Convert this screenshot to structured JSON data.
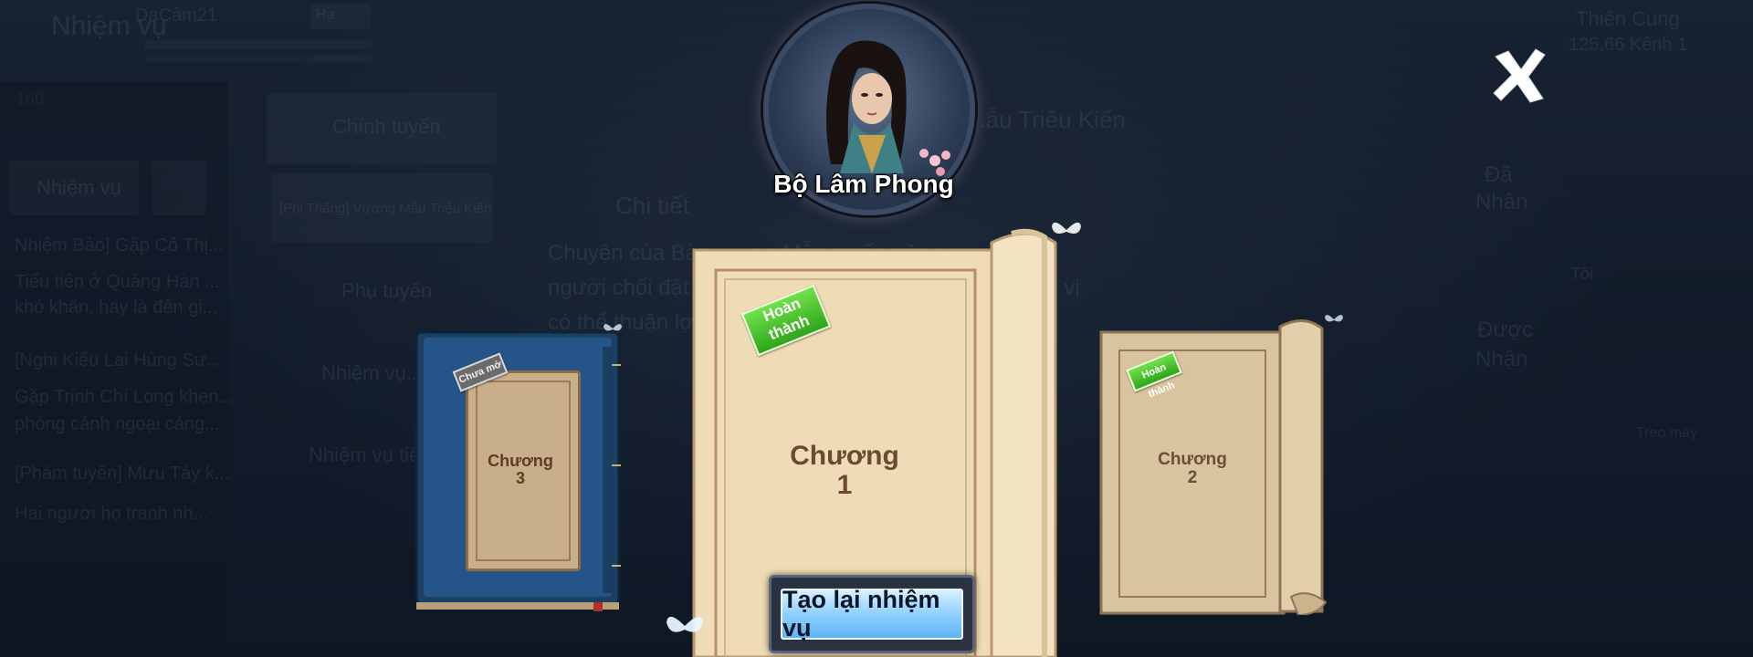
{
  "background": {
    "quest_title": "Nhiệm vụ",
    "player_name": "DaCâm21",
    "level": "160",
    "tab_main": "Chính tuyến",
    "tab_quest": "Nhiệm vụ",
    "quest_item": "[Phi Thăng] Vương Mẫu Triệu Kiến",
    "tab_side": "Phụ tuyến",
    "tab_daily": "Nhiệm vụ...",
    "tab_daily2": "Nhiệm vụ tiêu...",
    "detail_title": "Chi tiết",
    "detail_header": "...ẫu Triệu Kiến",
    "detail_line1": "Chuyện của Bàn... ...ng Mẫu muốn gặp ngươi,",
    "detail_line2": "người chối đặt c... ...hỏ nhiệm vụ khó cao, mong các vị",
    "detail_line3": "có thể thuận lợi...",
    "left_line1": "Nhiệm Bảo] Gặp Cô Thị...",
    "left_line2": "Tiểu tiên ở Quảng Hàn ...",
    "left_line3": "khó khăn, hay là đến gi...",
    "left_line4": "[Nghi Kiếu Lại Hùng Sư...",
    "left_line5": "Gặp Trịnh Chí Long khẹn...",
    "left_line6": "phòng cảnh ngoại cảng...",
    "left_line7": "[Phàm tuyến] Mưu Táy k...",
    "left_line8": "Hai người họ tranh nh...",
    "server": "Thiên Cung",
    "server_line": "125.66 Kênh 1",
    "right_a": "Đã",
    "right_b": "Nhận",
    "right_c": "Được",
    "right_d": "Nhận",
    "right_e": "Tôi",
    "right_f": "Treo máy",
    "badge": "Ha"
  },
  "hero": {
    "name": "Bộ Lâm Phong"
  },
  "chapters": {
    "left": {
      "label_line1": "Chương",
      "label_line2": "3",
      "stamp": "Chưa mở"
    },
    "center": {
      "label_line1": "Chương",
      "label_line2": "1",
      "stamp": "Hoàn thành"
    },
    "right": {
      "label_line1": "Chương",
      "label_line2": "2",
      "stamp": "Hoàn thành"
    }
  },
  "actions": {
    "reset_label": "Tạo lại nhiệm vụ"
  },
  "colors": {
    "accent_blue": "#8fd0ff",
    "stamp_green": "#3fb626",
    "scroll": "#f0dfb8"
  }
}
